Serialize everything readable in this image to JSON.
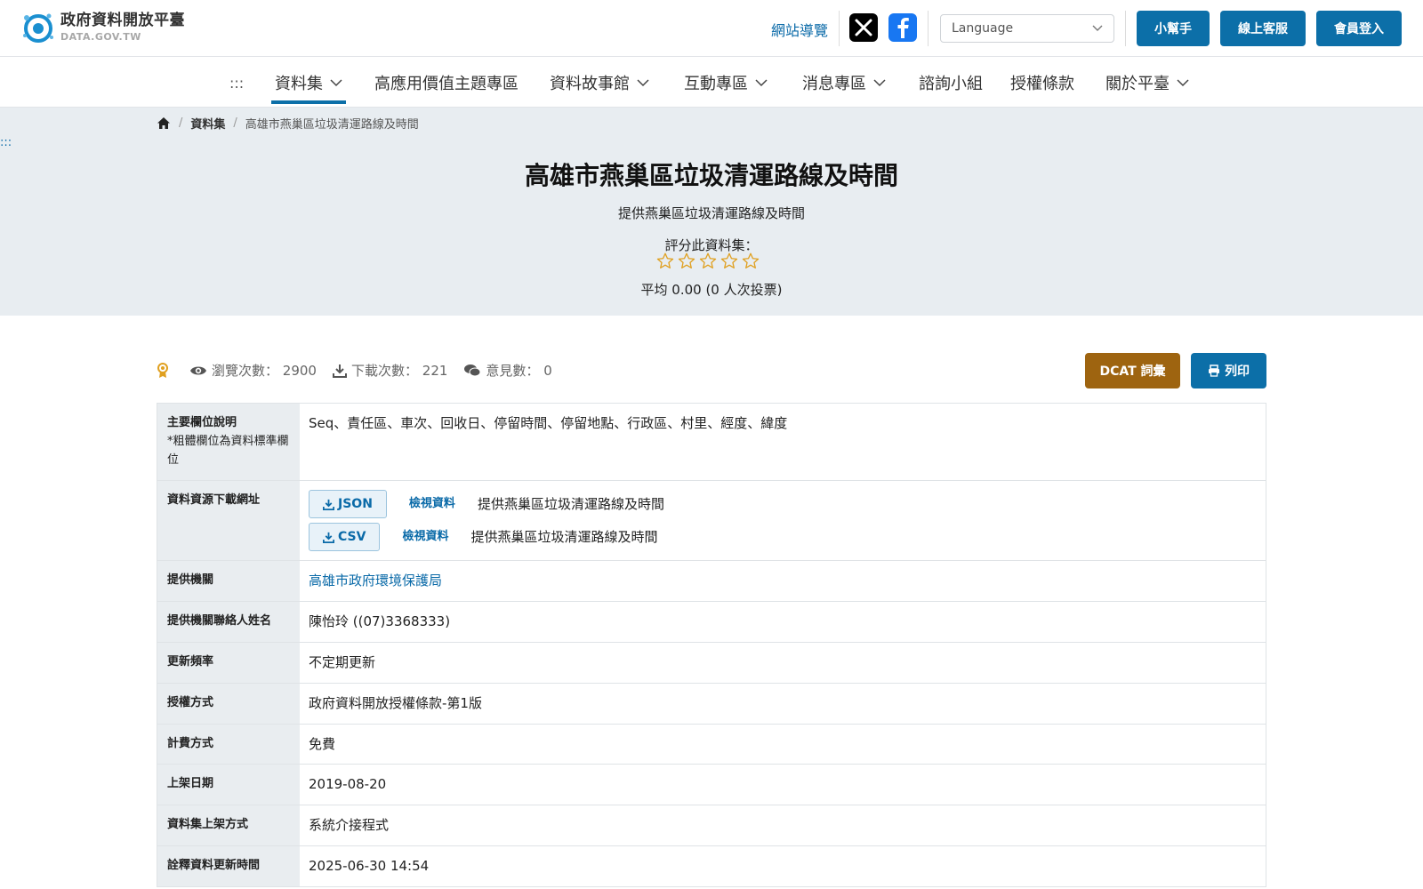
{
  "header": {
    "logo_title": "政府資料開放平臺",
    "logo_sub": "DATA.GOV.TW",
    "sitemap": "網站導覽",
    "language_placeholder": "Language",
    "buttons": [
      "小幫手",
      "線上客服",
      "會員登入"
    ]
  },
  "nav": {
    "accesskey": ":::",
    "items": [
      {
        "label": "資料集"
      },
      {
        "label": "高應用價值主題專區"
      },
      {
        "label": "資料故事館"
      },
      {
        "label": "互動專區"
      },
      {
        "label": "消息專區"
      },
      {
        "label": "諮詢小組"
      },
      {
        "label": "授權條款"
      },
      {
        "label": "關於平臺"
      }
    ]
  },
  "banner": {
    "accesskey": ":::",
    "breadcrumb": [
      "資料集",
      "高雄市燕巢區垃圾清運路線及時間"
    ],
    "title": "高雄市燕巢區垃圾清運路線及時間",
    "description": "提供燕巢區垃圾清運路線及時間",
    "rate_label": "評分此資料集：",
    "rating": 0,
    "rating_max": 5,
    "average_text": "平均 0.00 (0 人次投票)"
  },
  "stats": {
    "views_label": "瀏覽次數：",
    "views": "2900",
    "downloads_label": "下載次數：",
    "downloads": "221",
    "comments_label": "意見數：",
    "comments": "0",
    "dcat_button": "DCAT 詞彙",
    "print_button": "列印"
  },
  "table": {
    "fields_label": "主要欄位說明",
    "fields_note": "*粗體欄位為資料標準欄位",
    "fields_value": "Seq、責任區、車次、回收日、停留時間、停留地點、行政區、村里、經度、緯度",
    "download_label": "資料資源下載網址",
    "downloads": [
      {
        "format": "JSON",
        "view": "檢視資料",
        "desc": "提供燕巢區垃圾清運路線及時間"
      },
      {
        "format": "CSV",
        "view": "檢視資料",
        "desc": "提供燕巢區垃圾清運路線及時間"
      }
    ],
    "rows": [
      {
        "label": "提供機關",
        "value": "高雄市政府環境保護局"
      },
      {
        "label": "提供機關聯絡人姓名",
        "value": "陳怡玲 ((07)3368333)"
      },
      {
        "label": "更新頻率",
        "value": "不定期更新"
      },
      {
        "label": "授權方式",
        "value": "政府資料開放授權條款-第1版"
      },
      {
        "label": "計費方式",
        "value": "免費"
      },
      {
        "label": "上架日期",
        "value": "2019-08-20"
      },
      {
        "label": "資料集上架方式",
        "value": "系統介接程式"
      },
      {
        "label": "詮釋資料更新時間",
        "value": "2025-06-30 14:54"
      }
    ]
  },
  "colors": {
    "primary": "#0c6fa8",
    "dcat": "#9e6410",
    "star": "#e0a020",
    "banner_bg": "#e8edf1"
  }
}
